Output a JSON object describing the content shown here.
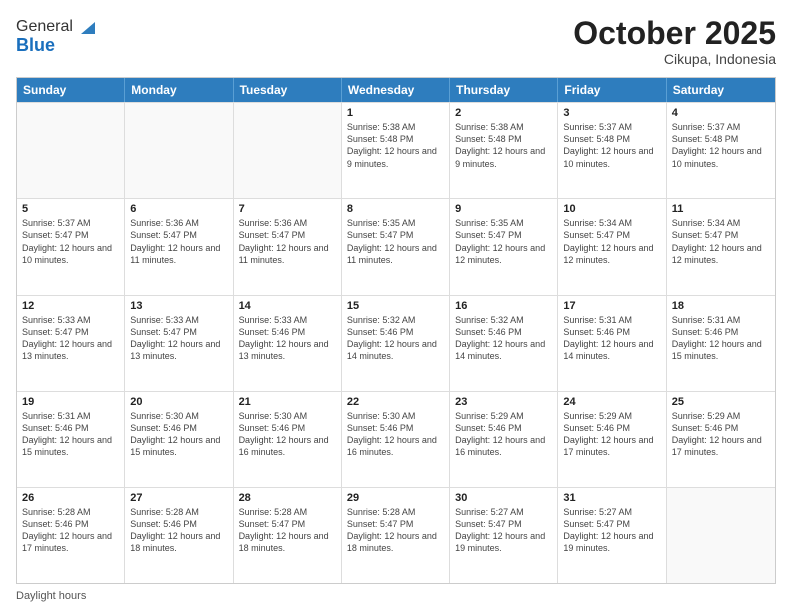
{
  "header": {
    "logo_line1": "General",
    "logo_line2": "Blue",
    "month_title": "October 2025",
    "location": "Cikupa, Indonesia"
  },
  "weekdays": [
    "Sunday",
    "Monday",
    "Tuesday",
    "Wednesday",
    "Thursday",
    "Friday",
    "Saturday"
  ],
  "footer": {
    "label": "Daylight hours"
  },
  "weeks": [
    [
      {
        "day": "",
        "info": ""
      },
      {
        "day": "",
        "info": ""
      },
      {
        "day": "",
        "info": ""
      },
      {
        "day": "1",
        "info": "Sunrise: 5:38 AM\nSunset: 5:48 PM\nDaylight: 12 hours and 9 minutes."
      },
      {
        "day": "2",
        "info": "Sunrise: 5:38 AM\nSunset: 5:48 PM\nDaylight: 12 hours and 9 minutes."
      },
      {
        "day": "3",
        "info": "Sunrise: 5:37 AM\nSunset: 5:48 PM\nDaylight: 12 hours and 10 minutes."
      },
      {
        "day": "4",
        "info": "Sunrise: 5:37 AM\nSunset: 5:48 PM\nDaylight: 12 hours and 10 minutes."
      }
    ],
    [
      {
        "day": "5",
        "info": "Sunrise: 5:37 AM\nSunset: 5:47 PM\nDaylight: 12 hours and 10 minutes."
      },
      {
        "day": "6",
        "info": "Sunrise: 5:36 AM\nSunset: 5:47 PM\nDaylight: 12 hours and 11 minutes."
      },
      {
        "day": "7",
        "info": "Sunrise: 5:36 AM\nSunset: 5:47 PM\nDaylight: 12 hours and 11 minutes."
      },
      {
        "day": "8",
        "info": "Sunrise: 5:35 AM\nSunset: 5:47 PM\nDaylight: 12 hours and 11 minutes."
      },
      {
        "day": "9",
        "info": "Sunrise: 5:35 AM\nSunset: 5:47 PM\nDaylight: 12 hours and 12 minutes."
      },
      {
        "day": "10",
        "info": "Sunrise: 5:34 AM\nSunset: 5:47 PM\nDaylight: 12 hours and 12 minutes."
      },
      {
        "day": "11",
        "info": "Sunrise: 5:34 AM\nSunset: 5:47 PM\nDaylight: 12 hours and 12 minutes."
      }
    ],
    [
      {
        "day": "12",
        "info": "Sunrise: 5:33 AM\nSunset: 5:47 PM\nDaylight: 12 hours and 13 minutes."
      },
      {
        "day": "13",
        "info": "Sunrise: 5:33 AM\nSunset: 5:47 PM\nDaylight: 12 hours and 13 minutes."
      },
      {
        "day": "14",
        "info": "Sunrise: 5:33 AM\nSunset: 5:46 PM\nDaylight: 12 hours and 13 minutes."
      },
      {
        "day": "15",
        "info": "Sunrise: 5:32 AM\nSunset: 5:46 PM\nDaylight: 12 hours and 14 minutes."
      },
      {
        "day": "16",
        "info": "Sunrise: 5:32 AM\nSunset: 5:46 PM\nDaylight: 12 hours and 14 minutes."
      },
      {
        "day": "17",
        "info": "Sunrise: 5:31 AM\nSunset: 5:46 PM\nDaylight: 12 hours and 14 minutes."
      },
      {
        "day": "18",
        "info": "Sunrise: 5:31 AM\nSunset: 5:46 PM\nDaylight: 12 hours and 15 minutes."
      }
    ],
    [
      {
        "day": "19",
        "info": "Sunrise: 5:31 AM\nSunset: 5:46 PM\nDaylight: 12 hours and 15 minutes."
      },
      {
        "day": "20",
        "info": "Sunrise: 5:30 AM\nSunset: 5:46 PM\nDaylight: 12 hours and 15 minutes."
      },
      {
        "day": "21",
        "info": "Sunrise: 5:30 AM\nSunset: 5:46 PM\nDaylight: 12 hours and 16 minutes."
      },
      {
        "day": "22",
        "info": "Sunrise: 5:30 AM\nSunset: 5:46 PM\nDaylight: 12 hours and 16 minutes."
      },
      {
        "day": "23",
        "info": "Sunrise: 5:29 AM\nSunset: 5:46 PM\nDaylight: 12 hours and 16 minutes."
      },
      {
        "day": "24",
        "info": "Sunrise: 5:29 AM\nSunset: 5:46 PM\nDaylight: 12 hours and 17 minutes."
      },
      {
        "day": "25",
        "info": "Sunrise: 5:29 AM\nSunset: 5:46 PM\nDaylight: 12 hours and 17 minutes."
      }
    ],
    [
      {
        "day": "26",
        "info": "Sunrise: 5:28 AM\nSunset: 5:46 PM\nDaylight: 12 hours and 17 minutes."
      },
      {
        "day": "27",
        "info": "Sunrise: 5:28 AM\nSunset: 5:46 PM\nDaylight: 12 hours and 18 minutes."
      },
      {
        "day": "28",
        "info": "Sunrise: 5:28 AM\nSunset: 5:47 PM\nDaylight: 12 hours and 18 minutes."
      },
      {
        "day": "29",
        "info": "Sunrise: 5:28 AM\nSunset: 5:47 PM\nDaylight: 12 hours and 18 minutes."
      },
      {
        "day": "30",
        "info": "Sunrise: 5:27 AM\nSunset: 5:47 PM\nDaylight: 12 hours and 19 minutes."
      },
      {
        "day": "31",
        "info": "Sunrise: 5:27 AM\nSunset: 5:47 PM\nDaylight: 12 hours and 19 minutes."
      },
      {
        "day": "",
        "info": ""
      }
    ]
  ]
}
